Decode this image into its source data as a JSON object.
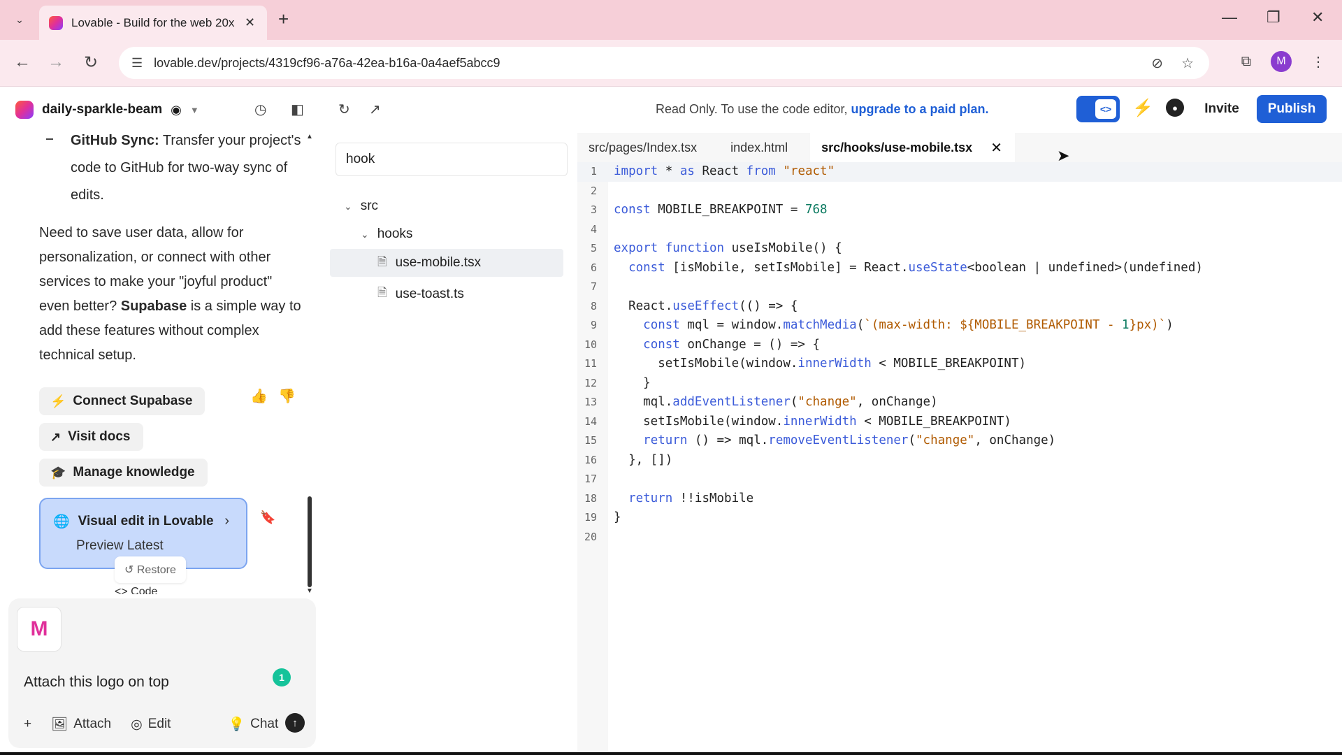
{
  "browser": {
    "tab_title": "Lovable - Build for the web 20x",
    "url": "lovable.dev/projects/4319cf96-a76a-42ea-b16a-0a4aef5abcc9",
    "avatar_letter": "M"
  },
  "header": {
    "project_name": "daily-sparkle-beam",
    "readonly_text": "Read Only. To use the code editor, ",
    "readonly_link": "upgrade to a paid plan.",
    "code_toggle_glyph": "<>",
    "invite_label": "Invite",
    "publish_label": "Publish"
  },
  "chat": {
    "bullet_bold": "GitHub Sync:",
    "bullet_text": " Transfer your project's code to GitHub for two-way sync of edits.",
    "para_prefix": "Need to save user data, allow for personalization, or connect with other services to make your \"joyful product\" even better? ",
    "para_bold": "Supabase",
    "para_suffix": " is a simple way to add these features without complex technical setup.",
    "btn_connect": "Connect Supabase",
    "btn_docs": "Visit docs",
    "btn_knowledge": "Manage knowledge",
    "visual_edit_title": "Visual edit in Lovable",
    "visual_edit_sub": "Preview Latest",
    "restore_label": "Restore",
    "code_label": "Code",
    "composer_thumb": "M",
    "prompt_text": "Attach this logo on top",
    "grammarly_count": "1",
    "tool_attach": "Attach",
    "tool_edit": "Edit",
    "tool_chat": "Chat"
  },
  "tree": {
    "search_value": "hook",
    "items": [
      "src",
      "hooks",
      "use-mobile.tsx",
      "use-toast.ts"
    ]
  },
  "editor": {
    "tabs": [
      "src/pages/Index.tsx",
      "index.html",
      "src/hooks/use-mobile.tsx"
    ],
    "lines": [
      "import * as React from \"react\"",
      "",
      "const MOBILE_BREAKPOINT = 768",
      "",
      "export function useIsMobile() {",
      "  const [isMobile, setIsMobile] = React.useState<boolean | undefined>(undefined)",
      "",
      "  React.useEffect(() => {",
      "    const mql = window.matchMedia(`(max-width: ${MOBILE_BREAKPOINT - 1}px)`)",
      "    const onChange = () => {",
      "      setIsMobile(window.innerWidth < MOBILE_BREAKPOINT)",
      "    }",
      "    mql.addEventListener(\"change\", onChange)",
      "    setIsMobile(window.innerWidth < MOBILE_BREAKPOINT)",
      "    return () => mql.removeEventListener(\"change\", onChange)",
      "  }, [])",
      "",
      "  return !!isMobile",
      "}",
      ""
    ]
  },
  "colors": {
    "accent": "#1f5fd6",
    "tabbar": "#f6cfd8",
    "visual_card": "#c8dafc",
    "kw": "#3b5bd9",
    "str": "#b05a00",
    "num": "#0b7a60"
  }
}
